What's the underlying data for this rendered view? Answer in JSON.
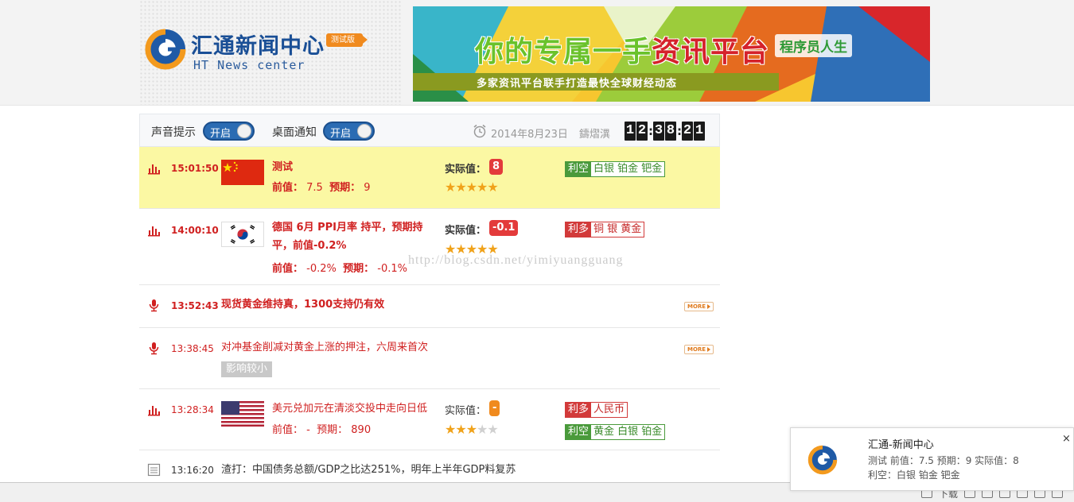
{
  "header": {
    "logo_title": "汇通新闻中心",
    "logo_badge": "测试版",
    "logo_subtitle": "HT News center",
    "banner": {
      "main_left": "你的专属一手",
      "main_right": "资讯平台",
      "brand": "程序员人生",
      "sub": "多家资讯平台联手打造最快全球财经动态"
    }
  },
  "toolbar": {
    "sound_label": "声音提示",
    "sound_toggle": "开启",
    "desktop_label": "桌面通知",
    "desktop_toggle": "开启",
    "date": "2014年8月23日",
    "user": "鑄熠潩",
    "clock_digits": [
      "1",
      "2",
      "3",
      "8",
      "2",
      "1"
    ]
  },
  "news": [
    {
      "time": "15:01:50",
      "title": "测试",
      "prev_label": "前值：",
      "prev_value": "7.5",
      "forecast_label": "预期：",
      "forecast_value": "9",
      "actual_label": "实际值：",
      "actual_value": "8",
      "stars": 5,
      "tags": [
        {
          "type": "利空",
          "values": "白银 铂金 钯金"
        }
      ]
    },
    {
      "time": "14:00:10",
      "title_line1": "德国 6月 PPI月率 持平，预期持",
      "title_line2": "平，前值-0.2%",
      "prev_label": "前值：",
      "prev_value": "-0.2%",
      "forecast_label": "预期：",
      "forecast_value": "-0.1%",
      "actual_label": "实际值：",
      "actual_value": "-0.1",
      "stars": 5,
      "tags": [
        {
          "type": "利多",
          "values": "铜 银 黄金"
        }
      ]
    },
    {
      "time": "13:52:43",
      "title": "现货黄金维持真，1300支持仍有效",
      "more": "MORE"
    },
    {
      "time": "13:38:45",
      "title": "对冲基金削减对黄金上涨的押注，六周来首次",
      "impact": "影响较小",
      "more": "MORE"
    },
    {
      "time": "13:28:34",
      "title": "美元兑加元在清淡交投中走向日低",
      "prev_label": "前值：",
      "prev_value": "-",
      "forecast_label": "预期：",
      "forecast_value": "890",
      "actual_label": "实际值：",
      "actual_value": "-",
      "stars": 3,
      "tags": [
        {
          "type": "利多",
          "values": "人民币"
        },
        {
          "type": "利空",
          "values": "黄金 白银 铂金"
        }
      ]
    },
    {
      "time": "13:16:20",
      "title": "渣打：中国债务总额/GDP之比达251%，明年上半年GDP料复苏"
    }
  ],
  "watermark": "http://blog.csdn.net/yimiyuangguang",
  "statusbar": {
    "download_label": "下载"
  },
  "notification": {
    "title": "汇通-新闻中心",
    "line1": "测试 前值：7.5 预期：9 实际值：8",
    "line2": "利空：白银 铂金 钯金",
    "close": "×"
  },
  "colors": {
    "accent_red": "#d02020",
    "highlight_row": "#fbf8a3",
    "toggle_blue": "#2b6cb3",
    "bullish_red": "#d23a3a",
    "bearish_green": "#4a9a3b",
    "star_orange": "#f0a21a"
  }
}
